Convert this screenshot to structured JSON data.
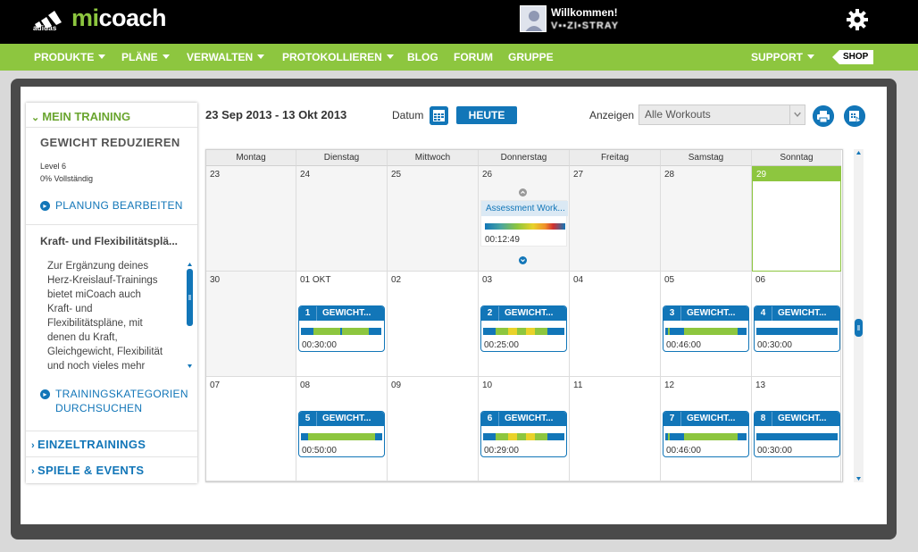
{
  "brand": {
    "logo_small": "adidas",
    "logo_mi": "mi",
    "logo_coach": "coach"
  },
  "user": {
    "welcome": "Willkommen!",
    "username": "V▪▪ZI▪STRAY"
  },
  "nav": {
    "items": [
      {
        "label": "PRODUKTE",
        "caret": true
      },
      {
        "label": "PLÄNE",
        "caret": true
      },
      {
        "label": "VERWALTEN",
        "caret": true
      },
      {
        "label": "PROTOKOLLIEREN",
        "caret": true
      },
      {
        "label": "BLOG",
        "caret": false
      },
      {
        "label": "FORUM",
        "caret": false
      },
      {
        "label": "GRUPPE",
        "caret": false
      }
    ],
    "support": "SUPPORT",
    "shop": "SHOP"
  },
  "sidebar": {
    "section_title": "MEIN TRAINING",
    "plan_title": "GEWICHT REDUZIEREN",
    "level": "Level 6",
    "progress": "0% Vollständig",
    "edit_link": "PLANUNG BEARBEITEN",
    "strength_title": "Kraft- und Flexibilitätsplä...",
    "strength_text": [
      "Zur Ergänzung deines",
      "Herz-Kreislauf-Trainings",
      "bietet miCoach auch",
      "Kraft- und",
      "Flexibilitätspläne, mit",
      "denen du Kraft,",
      "Gleichgewicht, Flexibilität",
      "und noch vieles mehr"
    ],
    "browse_link_1": "TRAININGSKATEGORIEN",
    "browse_link_2": "DURCHSUCHEN",
    "single_trainings": "EINZELTRAININGS",
    "games_events": "SPIELE & EVENTS"
  },
  "toolbar": {
    "date_range": "23 Sep 2013 - 13 Okt 2013",
    "datum_label": "Datum",
    "today_button": "HEUTE",
    "show_label": "Anzeigen",
    "filter_value": "Alle Workouts",
    "icons": [
      "calendar-icon",
      "print-icon",
      "export-icon"
    ]
  },
  "calendar": {
    "weekdays": [
      "Montag",
      "Dienstag",
      "Mittwoch",
      "Donnerstag",
      "Freitag",
      "Samstag",
      "Sonntag"
    ],
    "weeks": [
      [
        "23",
        "24",
        "25",
        "26",
        "27",
        "28",
        "29"
      ],
      [
        "30",
        "01 OKT",
        "02",
        "03",
        "04",
        "05",
        "06"
      ],
      [
        "07",
        "08",
        "09",
        "10",
        "11",
        "12",
        "13"
      ]
    ],
    "today_index": [
      0,
      6
    ],
    "assessment": {
      "title": "Assessment Work...",
      "time": "00:12:49",
      "week": 0,
      "day": 3
    },
    "workouts": [
      {
        "num": "1",
        "title": "GEWICHT...",
        "time": "00:30:00",
        "week": 1,
        "day": 1,
        "bar": [
          "b:14",
          "g:30",
          "b:2",
          "g:30",
          "b:2",
          "b:12"
        ]
      },
      {
        "num": "2",
        "title": "GEWICHT...",
        "time": "00:25:00",
        "week": 1,
        "day": 3,
        "bar": [
          "b:14",
          "g:14",
          "y:10",
          "g:10",
          "y:10",
          "g:14",
          "b:19"
        ]
      },
      {
        "num": "3",
        "title": "GEWICHT...",
        "time": "00:46:00",
        "week": 1,
        "day": 5,
        "bar": [
          "b:3",
          "g:2",
          "b:16",
          "g:60",
          "b:10"
        ]
      },
      {
        "num": "4",
        "title": "GEWICHT...",
        "time": "00:30:00",
        "week": 1,
        "day": 6,
        "bar": [
          "b:91"
        ]
      },
      {
        "num": "5",
        "title": "GEWICHT...",
        "time": "00:50:00",
        "week": 2,
        "day": 1,
        "bar": [
          "b:8",
          "g:75",
          "b:8"
        ]
      },
      {
        "num": "6",
        "title": "GEWICHT...",
        "time": "00:29:00",
        "week": 2,
        "day": 3,
        "bar": [
          "b:14",
          "g:14",
          "y:10",
          "g:10",
          "y:10",
          "g:14",
          "b:19"
        ]
      },
      {
        "num": "7",
        "title": "GEWICHT...",
        "time": "00:46:00",
        "week": 2,
        "day": 5,
        "bar": [
          "b:3",
          "g:2",
          "b:16",
          "g:60",
          "b:10"
        ]
      },
      {
        "num": "8",
        "title": "GEWICHT...",
        "time": "00:30:00",
        "week": 2,
        "day": 6,
        "bar": [
          "b:91"
        ]
      }
    ]
  },
  "colors": {
    "brand_green": "#8dc63f",
    "brand_blue": "#1276b8",
    "intensity_yellow": "#e9d22a"
  }
}
